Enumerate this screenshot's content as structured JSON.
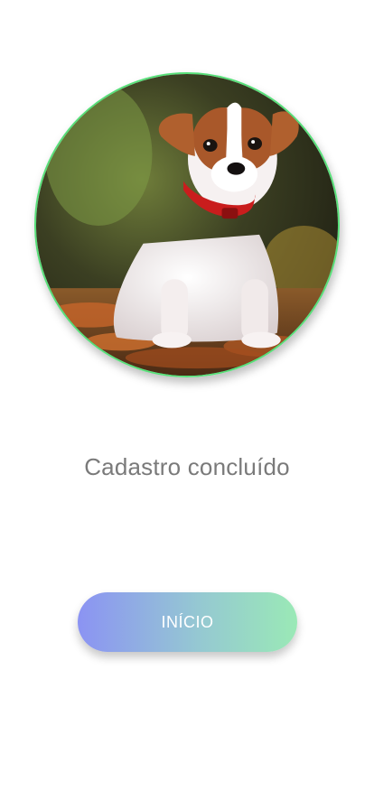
{
  "photo": {
    "icon": "puppy-photo",
    "border_color": "#58e07a"
  },
  "title": "Cadastro concluído",
  "start_button": {
    "label": "INÍCIO",
    "gradient": [
      "#8b93f3",
      "#9ae9b6"
    ]
  }
}
